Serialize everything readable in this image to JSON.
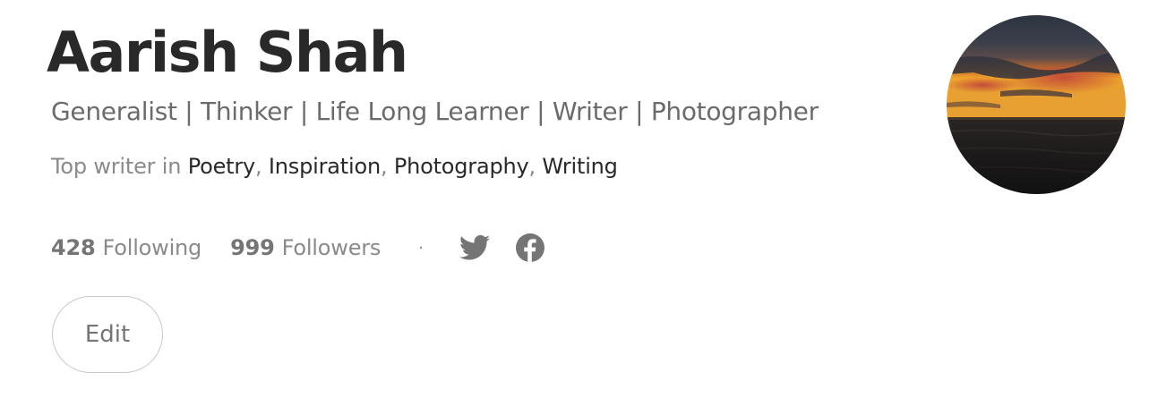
{
  "profile": {
    "name": "Aarish Shah",
    "bio": "Generalist | Thinker | Life Long Learner | Writer | Photographer",
    "top_writer": {
      "prefix": "Top writer in ",
      "topics": [
        "Poetry",
        "Inspiration",
        "Photography",
        "Writing"
      ],
      "separator": ", "
    },
    "stats": {
      "following_count": "428",
      "following_label": "Following",
      "followers_count": "999",
      "followers_label": "Followers",
      "separator": "·"
    },
    "social": {
      "icons": [
        "twitter-icon",
        "facebook-icon"
      ],
      "icon_color": "#757575"
    },
    "edit_label": "Edit",
    "avatar": {
      "description_icon": "sunset-over-sea-photo"
    }
  },
  "colors": {
    "name_text": "#292929",
    "secondary_text": "#6b6b6b",
    "muted_text": "#8a8a8a",
    "button_border": "#c8c8c8"
  }
}
